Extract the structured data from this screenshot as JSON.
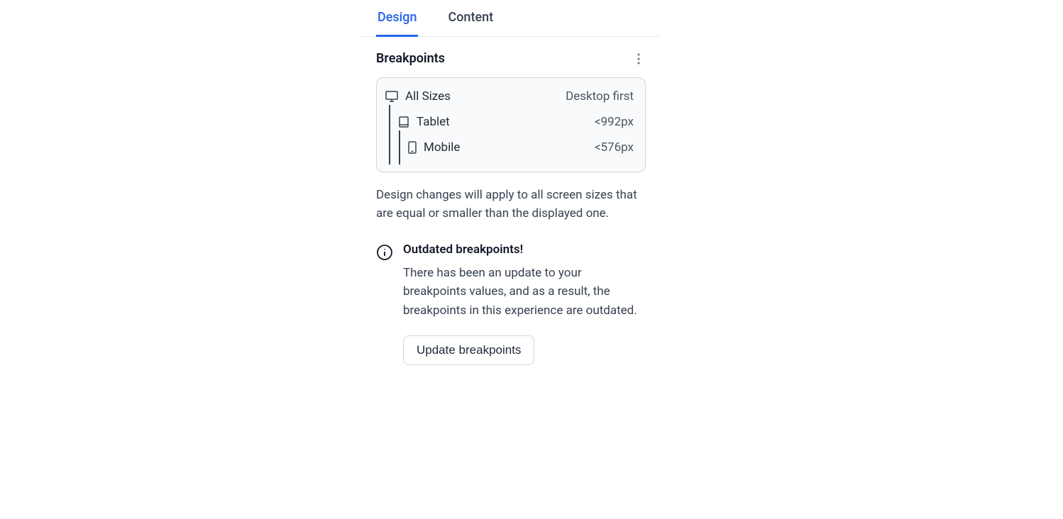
{
  "tabs": [
    {
      "label": "Design",
      "active": true
    },
    {
      "label": "Content",
      "active": false
    }
  ],
  "section": {
    "title": "Breakpoints"
  },
  "breakpoints": {
    "strategy": "Desktop first",
    "items": [
      {
        "label": "All Sizes",
        "value": "Desktop first",
        "icon": "desktop"
      },
      {
        "label": "Tablet",
        "value": "<992px",
        "icon": "tablet"
      },
      {
        "label": "Mobile",
        "value": "<576px",
        "icon": "mobile"
      }
    ]
  },
  "description": "Design changes will apply to all screen sizes that are equal or smaller than the displayed one.",
  "notice": {
    "title": "Outdated breakpoints!",
    "text": "There has been an update to your breakpoints values, and as a result, the breakpoints in this experience are outdated.",
    "button_label": "Update breakpoints"
  }
}
